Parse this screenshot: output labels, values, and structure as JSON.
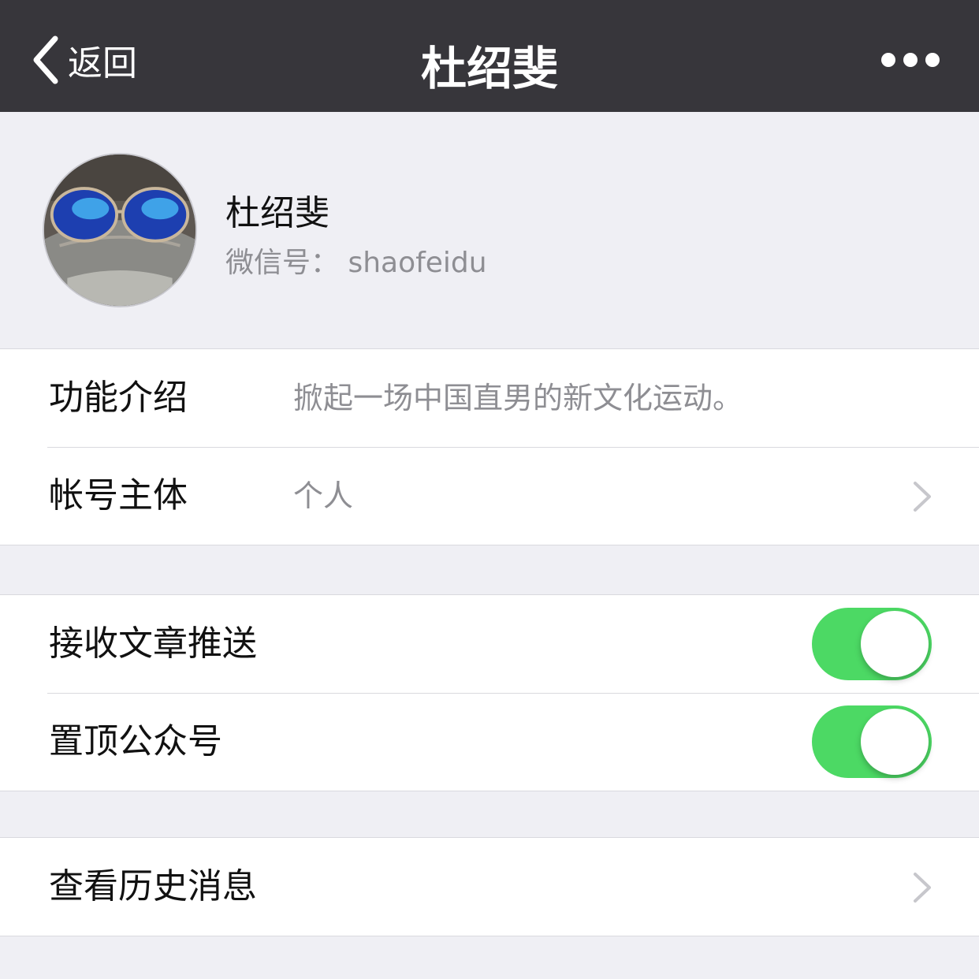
{
  "navbar": {
    "back_label": "返回",
    "title": "杜绍斐",
    "more_icon": "more-horizontal-icon"
  },
  "profile": {
    "name": "杜绍斐",
    "wechat_id": "微信号： shaofeidu",
    "avatar_icon": "avatar-sunglasses-photo"
  },
  "info": {
    "intro_label": "功能介绍",
    "intro_value": "掀起一场中国直男的新文化运动。",
    "account_label": "帐号主体",
    "account_value": "个人"
  },
  "settings": {
    "receive_label": "接收文章推送",
    "receive_on": true,
    "pin_label": "置顶公众号",
    "pin_on": true
  },
  "history": {
    "label": "查看历史消息"
  },
  "colors": {
    "navbar_bg": "#37363b",
    "page_bg": "#efeff4",
    "toggle_on": "#4cd964",
    "secondary_text": "#8e8e93"
  }
}
